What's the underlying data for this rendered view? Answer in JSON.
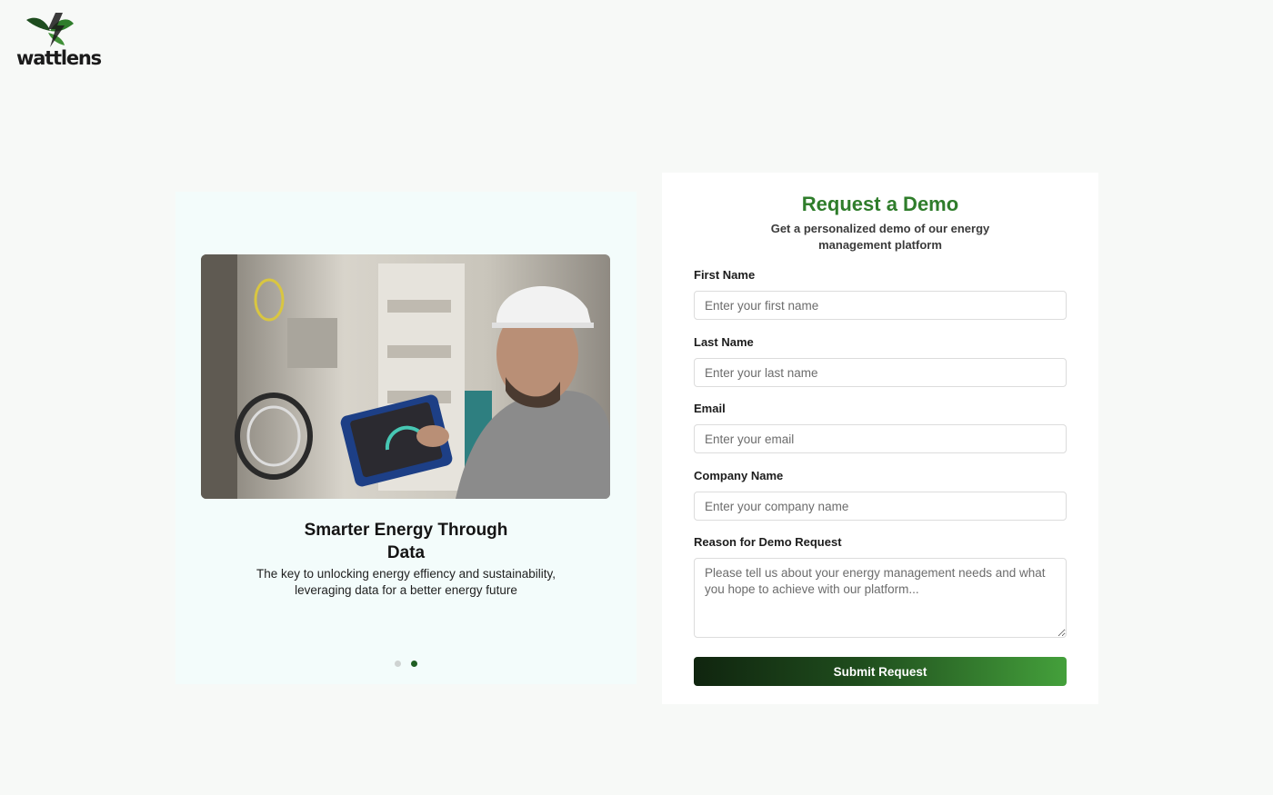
{
  "brand": {
    "name": "wattlens",
    "accent_color": "#2f7d2b",
    "logo_icon": "leaf-lightning-icon"
  },
  "carousel": {
    "image": "electrician-with-tablet-photo",
    "title": "Smarter Energy Through Data",
    "description": "The key to unlocking energy effiency and sustainability, leveraging data for a better energy future",
    "slide_count": 2,
    "active_slide": 2
  },
  "form": {
    "title": "Request a Demo",
    "subtitle": "Get a personalized demo of our energy management platform",
    "fields": [
      {
        "label": "First Name",
        "placeholder": "Enter your first name",
        "value": ""
      },
      {
        "label": "Last Name",
        "placeholder": "Enter your last name",
        "value": ""
      },
      {
        "label": "Email",
        "placeholder": "Enter your email",
        "value": ""
      },
      {
        "label": "Company Name",
        "placeholder": "Enter your company name",
        "value": ""
      }
    ],
    "reason": {
      "label": "Reason for Demo Request",
      "placeholder": "Please tell us about your energy management needs and what you hope to achieve with our platform..."
    },
    "submit_label": "Submit Request"
  }
}
